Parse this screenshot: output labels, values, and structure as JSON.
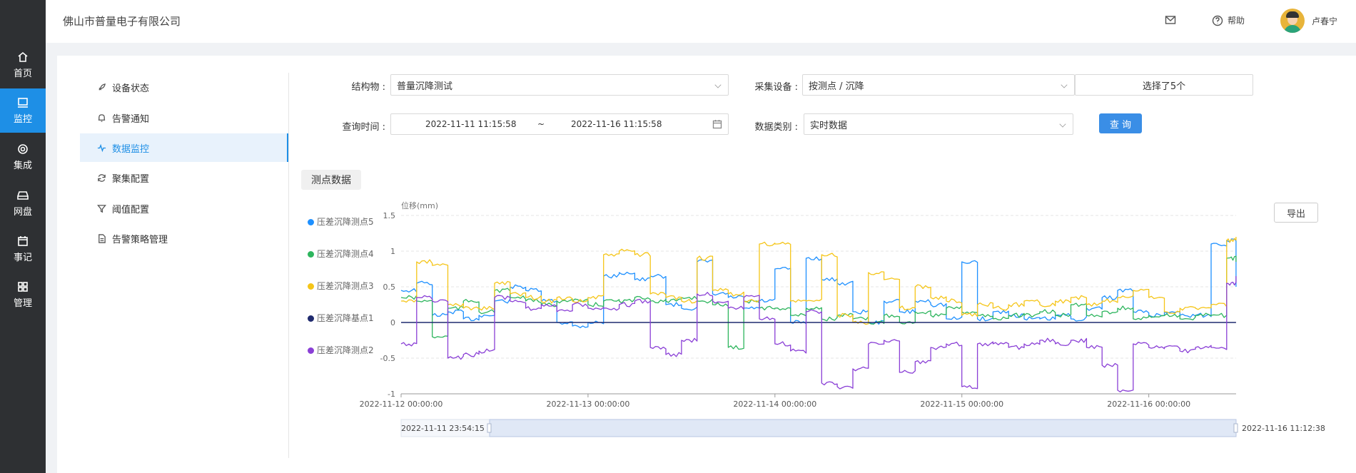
{
  "app": {
    "company": "佛山市普量电子有限公司"
  },
  "rail": {
    "items": [
      {
        "label": "首页",
        "icon": "home-icon"
      },
      {
        "label": "监控",
        "icon": "monitor-icon"
      },
      {
        "label": "集成",
        "icon": "gear-icon"
      },
      {
        "label": "网盘",
        "icon": "drive-icon"
      },
      {
        "label": "事记",
        "icon": "calendar-icon"
      },
      {
        "label": "管理",
        "icon": "grid-icon"
      }
    ]
  },
  "header": {
    "help_label": "帮助",
    "user_name": "卢春宁"
  },
  "submenu": {
    "items": [
      {
        "label": "设备状态",
        "icon": "rocket-icon"
      },
      {
        "label": "告警通知",
        "icon": "bell-icon"
      },
      {
        "label": "数据监控",
        "icon": "pulse-icon"
      },
      {
        "label": "聚集配置",
        "icon": "refresh-icon"
      },
      {
        "label": "阈值配置",
        "icon": "filter-icon"
      },
      {
        "label": "告警策略管理",
        "icon": "document-icon"
      }
    ]
  },
  "form": {
    "structure_label": "结构物 :",
    "structure_value": "普量沉降测试",
    "device_label": "采集设备 :",
    "device_value": "按测点 / 沉降",
    "selected_count": "选择了5个",
    "time_label": "查询时间 :",
    "time_start": "2022-11-11 11:15:58",
    "time_sep": "~",
    "time_end": "2022-11-16 11:15:58",
    "type_label": "数据类别 :",
    "type_value": "实时数据",
    "query_button": "查询"
  },
  "section": {
    "tag": "测点数据",
    "export_button": "导出"
  },
  "chart_data": {
    "type": "line",
    "ylabel": "位移(mm)",
    "ylim": [
      -1,
      1.5
    ],
    "yticks": [
      "1.5",
      "1",
      "0.5",
      "0",
      "-0.5",
      "-1"
    ],
    "xlim": [
      "2022-11-12 00:00:00",
      "2022-11-16 11:12:38"
    ],
    "xticks": [
      "2022-11-12 00:00:00",
      "2022-11-13 00:00:00",
      "2022-11-14 00:00:00",
      "2022-11-15 00:00:00",
      "2022-11-16 00:00:00"
    ],
    "grid": true,
    "legend": "left",
    "zoom_start": "2022-11-11 23:54:15",
    "zoom_end": "2022-11-16 11:12:38",
    "x": [
      "2022-11-12 00:00",
      "2022-11-12 02:00",
      "2022-11-12 04:00",
      "2022-11-12 06:00",
      "2022-11-12 08:00",
      "2022-11-12 10:00",
      "2022-11-12 12:00",
      "2022-11-12 14:00",
      "2022-11-12 16:00",
      "2022-11-12 18:00",
      "2022-11-12 20:00",
      "2022-11-12 22:00",
      "2022-11-13 00:00",
      "2022-11-13 02:00",
      "2022-11-13 04:00",
      "2022-11-13 06:00",
      "2022-11-13 08:00",
      "2022-11-13 10:00",
      "2022-11-13 12:00",
      "2022-11-13 14:00",
      "2022-11-13 16:00",
      "2022-11-13 18:00",
      "2022-11-13 20:00",
      "2022-11-13 22:00",
      "2022-11-14 00:00",
      "2022-11-14 02:00",
      "2022-11-14 04:00",
      "2022-11-14 06:00",
      "2022-11-14 08:00",
      "2022-11-14 10:00",
      "2022-11-14 12:00",
      "2022-11-14 14:00",
      "2022-11-14 16:00",
      "2022-11-14 18:00",
      "2022-11-14 20:00",
      "2022-11-14 22:00",
      "2022-11-15 00:00",
      "2022-11-15 02:00",
      "2022-11-15 04:00",
      "2022-11-15 06:00",
      "2022-11-15 08:00",
      "2022-11-15 10:00",
      "2022-11-15 12:00",
      "2022-11-15 14:00",
      "2022-11-15 16:00",
      "2022-11-15 18:00",
      "2022-11-15 20:00",
      "2022-11-15 22:00",
      "2022-11-16 00:00",
      "2022-11-16 02:00",
      "2022-11-16 04:00",
      "2022-11-16 06:00",
      "2022-11-16 08:00",
      "2022-11-16 10:00",
      "2022-11-16 11:12"
    ],
    "series": [
      {
        "name": "压差沉降测点5",
        "color": "#1e90ff",
        "values": [
          0.45,
          0.55,
          0.1,
          0.15,
          0.05,
          0.1,
          0.3,
          0.5,
          0.45,
          0.3,
          0.0,
          -0.05,
          0.0,
          0.65,
          0.7,
          0.6,
          0.65,
          0.25,
          0.2,
          0.85,
          0.4,
          0.35,
          0.2,
          0.3,
          0.75,
          0.0,
          0.9,
          0.6,
          0.55,
          0.15,
          0.0,
          0.3,
          0.15,
          0.3,
          0.25,
          0.05,
          0.85,
          0.05,
          0.15,
          0.1,
          0.05,
          0.05,
          0.1,
          0.05,
          0.2,
          0.35,
          0.45,
          0.15,
          0.1,
          0.15,
          0.1,
          0.1,
          1.1,
          1.15,
          0.5
        ]
      },
      {
        "name": "压差沉降测点4",
        "color": "#2db55d",
        "values": [
          0.35,
          0.3,
          -0.2,
          0.2,
          0.3,
          0.15,
          0.45,
          0.35,
          0.3,
          0.25,
          0.3,
          0.3,
          0.25,
          0.3,
          0.3,
          0.35,
          0.3,
          0.3,
          0.35,
          0.3,
          0.25,
          -0.35,
          0.3,
          0.2,
          0.2,
          0.1,
          0.2,
          0.05,
          0.1,
          0.05,
          0.0,
          0.1,
          0.0,
          0.15,
          0.1,
          0.2,
          0.15,
          0.1,
          0.05,
          0.1,
          0.1,
          0.15,
          0.1,
          0.25,
          0.1,
          0.15,
          0.2,
          0.05,
          0.1,
          0.1,
          0.05,
          0.1,
          0.1,
          0.9,
          0.85
        ]
      },
      {
        "name": "压差沉降测点3",
        "color": "#f5c518",
        "values": [
          0.3,
          0.85,
          0.8,
          0.25,
          0.2,
          0.2,
          0.55,
          0.4,
          0.35,
          0.3,
          0.35,
          0.3,
          0.35,
          0.95,
          1.0,
          0.95,
          0.4,
          0.35,
          0.3,
          0.9,
          0.45,
          0.4,
          0.3,
          1.1,
          1.1,
          0.3,
          0.3,
          0.95,
          0.1,
          0.0,
          0.7,
          0.6,
          0.2,
          0.5,
          0.35,
          0.3,
          0.1,
          0.25,
          0.2,
          0.25,
          0.3,
          0.25,
          0.3,
          0.35,
          0.25,
          0.3,
          0.35,
          0.45,
          0.35,
          0.15,
          0.2,
          0.2,
          0.25,
          1.15,
          1.2
        ]
      },
      {
        "name": "压差沉降基点1",
        "color": "#1f2a6e",
        "values": [
          0.0,
          0.0,
          0.0,
          0.0,
          0.0,
          0.0,
          0.0,
          0.0,
          0.0,
          0.0,
          0.0,
          0.0,
          0.0,
          0.0,
          0.0,
          0.0,
          0.0,
          0.0,
          0.0,
          0.0,
          0.0,
          0.0,
          0.0,
          0.0,
          0.0,
          0.0,
          0.0,
          0.0,
          0.0,
          0.0,
          0.0,
          0.0,
          0.0,
          0.0,
          0.0,
          0.0,
          0.0,
          0.0,
          0.0,
          0.0,
          0.0,
          0.0,
          0.0,
          0.0,
          0.0,
          0.0,
          0.0,
          0.0,
          0.0,
          0.0,
          0.0,
          0.0,
          0.0,
          0.0,
          0.0
        ]
      },
      {
        "name": "压差沉降测点2",
        "color": "#8a3fd6",
        "values": [
          -0.3,
          0.35,
          0.3,
          -0.5,
          -0.45,
          -0.4,
          0.35,
          0.3,
          0.2,
          0.25,
          0.15,
          0.25,
          0.2,
          0.2,
          0.25,
          0.3,
          -0.35,
          -0.45,
          -0.25,
          0.4,
          0.3,
          0.2,
          0.35,
          0.05,
          -0.3,
          -0.4,
          0.15,
          -0.85,
          -0.9,
          -0.65,
          -0.3,
          -0.25,
          -0.7,
          -0.55,
          -0.35,
          -0.3,
          -0.9,
          -0.3,
          -0.3,
          -0.35,
          -0.3,
          -0.25,
          -0.3,
          -0.25,
          -0.35,
          -0.6,
          -0.95,
          -0.3,
          -0.35,
          -0.35,
          -0.4,
          -0.35,
          -0.35,
          0.55,
          0.65
        ]
      }
    ]
  }
}
